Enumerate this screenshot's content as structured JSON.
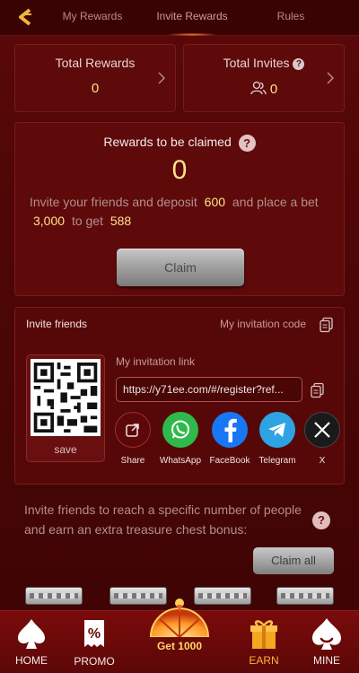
{
  "nav": {
    "tabs": [
      {
        "label": "My Rewards"
      },
      {
        "label": "Invite Rewards"
      },
      {
        "label": "Rules"
      }
    ],
    "active_tab": "Invite Rewards"
  },
  "summary": {
    "total_rewards": {
      "title": "Total Rewards",
      "value": "0"
    },
    "total_invites": {
      "title": "Total Invites",
      "value": "0"
    }
  },
  "claim": {
    "title": "Rewards to be claimed",
    "amount": "0",
    "desc_1": "Invite your friends and deposit",
    "deposit": "600",
    "desc_2": "and place a bet",
    "bet": "3,000",
    "desc_3": "to get",
    "reward": "588",
    "button": "Claim"
  },
  "invite": {
    "heading": "Invite friends",
    "code_label": "My invitation code",
    "qr_save": "save",
    "link_label": "My invitation link",
    "link_value": "https://y71ee.com/#/register?ref...",
    "share": [
      {
        "label": "Share",
        "icon": "share-icon",
        "color": "#5c0808"
      },
      {
        "label": "WhatsApp",
        "icon": "whatsapp-icon",
        "color": "#2fb94a"
      },
      {
        "label": "FaceBook",
        "icon": "facebook-icon",
        "color": "#1877f2"
      },
      {
        "label": "Telegram",
        "icon": "telegram-icon",
        "color": "#2ea3e3"
      },
      {
        "label": "X",
        "icon": "x-icon",
        "color": "#1a1a1a"
      }
    ]
  },
  "bonus": {
    "text": "Invite friends to reach a specific number of people and earn an extra treasure chest bonus:",
    "button": "Claim all"
  },
  "bottom_nav": {
    "items": [
      {
        "label": "HOME",
        "icon": "home-spade-icon"
      },
      {
        "label": "PROMO",
        "icon": "promo-percent-icon"
      },
      {
        "label": "Get 1000",
        "icon": "wheel-icon"
      },
      {
        "label": "EARN",
        "icon": "gift-icon"
      },
      {
        "label": "MINE",
        "icon": "mine-spade-icon"
      }
    ],
    "active": "EARN"
  },
  "colors": {
    "background": "#4d0606",
    "card": "#5e0a0a",
    "highlight": "#ffe28a",
    "active_nav": "#ffb33a"
  }
}
